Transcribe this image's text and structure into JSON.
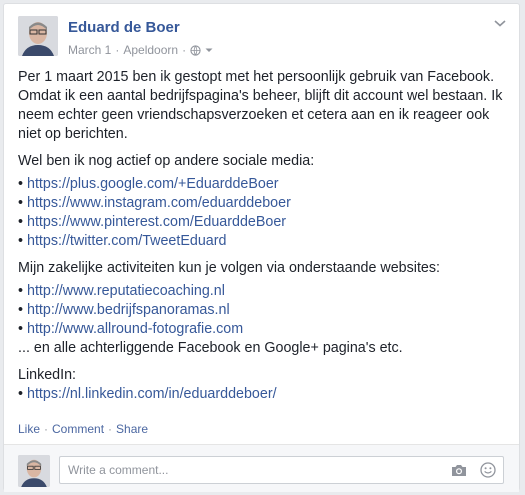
{
  "post": {
    "author": "Eduard de Boer",
    "date": "March 1",
    "location": "Apeldoorn",
    "paragraph1": "Per 1 maart 2015 ben ik gestopt met het persoonlijk gebruik van Facebook. Omdat ik een aantal bedrijfspagina's beheer, blijft dit account wel bestaan. Ik neem echter geen vriendschapsverzoeken et cetera aan en ik reageer ook niet op berichten.",
    "social_intro": "Wel ben ik nog actief op andere sociale media:",
    "social_links": [
      "https://plus.google.com/+EduarddeBoer",
      "https://www.instagram.com/eduarddeboer",
      "https://www.pinterest.com/EduarddeBoer",
      "https://twitter.com/TweetEduard"
    ],
    "business_intro": "Mijn zakelijke activiteiten kun je volgen via onderstaande websites:",
    "business_links": [
      "http://www.reputatiecoaching.nl",
      "http://www.bedrijfspanoramas.nl",
      "http://www.allround-fotografie.com"
    ],
    "business_outro": "... en alle achterliggende Facebook en Google+ pagina's etc.",
    "linkedin_intro": "LinkedIn:",
    "linkedin_link": "https://nl.linkedin.com/in/eduarddeboer/",
    "bullet": "•"
  },
  "actions": {
    "like": "Like",
    "comment": "Comment",
    "share": "Share",
    "separator": "·"
  },
  "comment_box": {
    "placeholder": "Write a comment..."
  },
  "icons": {
    "privacy": "globe-icon",
    "menu": "chevron-down-icon",
    "camera": "camera-icon",
    "emoji": "smiley-icon"
  },
  "colors": {
    "link": "#365899",
    "meta": "#90949c",
    "background": "#e9ebee"
  }
}
